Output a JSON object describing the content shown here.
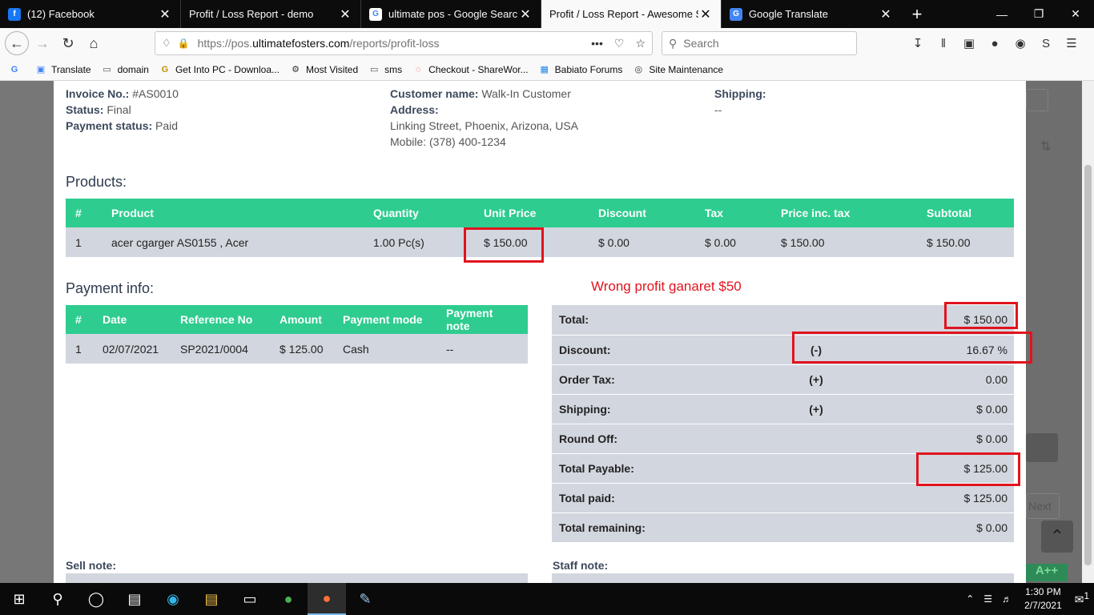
{
  "browser": {
    "tabs": [
      {
        "title": "(12) Facebook",
        "icon": "facebook-icon",
        "color": "#1877f2",
        "glyph": "f"
      },
      {
        "title": "Profit / Loss Report - demo",
        "icon": "none",
        "color": "",
        "glyph": ""
      },
      {
        "title": "ultimate pos - Google Search",
        "icon": "google-icon",
        "color": "#ffffff",
        "glyph": "G"
      },
      {
        "title": "Profit / Loss Report - Awesome Sho",
        "icon": "none",
        "color": "",
        "glyph": "",
        "active": true
      },
      {
        "title": "Google Translate",
        "icon": "translate-icon",
        "color": "#4285f4",
        "glyph": "G"
      }
    ],
    "url_prefix": "https://pos.",
    "url_domain": "ultimatefosters.com",
    "url_path": "/reports/profit-loss",
    "search_placeholder": "Search",
    "bookmarks": [
      "Translate",
      "domain",
      "Get Into PC - Downloa...",
      "Most Visited",
      "sms",
      "Checkout - ShareWor...",
      "Babiato Forums",
      "Site Maintenance"
    ]
  },
  "invoice": {
    "invoice_no_label": "Invoice No.:",
    "invoice_no": "#AS0010",
    "status_label": "Status:",
    "status": "Final",
    "payment_status_label": "Payment status:",
    "payment_status": "Paid",
    "customer_label": "Customer name:",
    "customer": "Walk-In Customer",
    "address_label": "Address:",
    "address_line": "Linking Street, Phoenix, Arizona, USA",
    "mobile": "Mobile: (378) 400-1234",
    "shipping_label": "Shipping:",
    "shipping_value": "--"
  },
  "products": {
    "title": "Products:",
    "headers": [
      "#",
      "Product",
      "Quantity",
      "Unit Price",
      "Discount",
      "Tax",
      "Price inc. tax",
      "Subtotal"
    ],
    "rows": [
      [
        "1",
        "acer cgarger AS0155 , Acer",
        "1.00 Pc(s)",
        "$ 150.00",
        "$ 0.00",
        "$ 0.00",
        "$ 150.00",
        "$ 150.00"
      ]
    ]
  },
  "payment": {
    "title": "Payment info:",
    "headers": [
      "#",
      "Date",
      "Reference No",
      "Amount",
      "Payment mode",
      "Payment note"
    ],
    "rows": [
      [
        "1",
        "02/07/2021",
        "SP2021/0004",
        "$ 125.00",
        "Cash",
        "--"
      ]
    ]
  },
  "annotation": "Wrong profit ganaret   $50",
  "totals": [
    {
      "label": "Total:",
      "sign": "",
      "value": "$ 150.00"
    },
    {
      "label": "Discount:",
      "sign": "(-)",
      "value": "16.67 %"
    },
    {
      "label": "Order Tax:",
      "sign": "(+)",
      "value": "0.00"
    },
    {
      "label": "Shipping:",
      "sign": "(+)",
      "value": "$ 0.00"
    },
    {
      "label": "Round Off:",
      "sign": "",
      "value": "$ 0.00"
    },
    {
      "label": "Total Payable:",
      "sign": "",
      "value": "$ 125.00"
    },
    {
      "label": "Total paid:",
      "sign": "",
      "value": "$ 125.00"
    },
    {
      "label": "Total remaining:",
      "sign": "",
      "value": "$ 0.00"
    }
  ],
  "notes": {
    "sell": "Sell note:",
    "staff": "Staff note:"
  },
  "background": {
    "next": "Next",
    "badge": "A++"
  },
  "taskbar": {
    "time": "1:30 PM",
    "date": "2/7/2021",
    "notif_count": "1"
  }
}
